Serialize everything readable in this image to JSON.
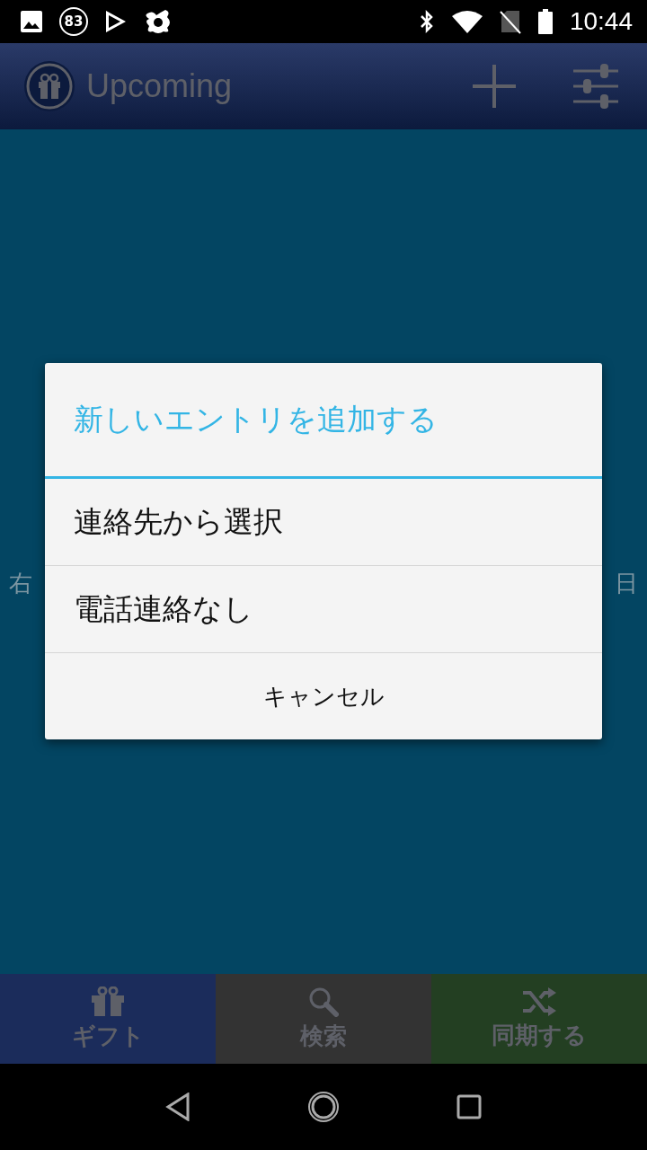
{
  "status_bar": {
    "notification_count": "83",
    "time": "10:44"
  },
  "app_bar": {
    "title": "Upcoming"
  },
  "background_text": {
    "left": "右",
    "right": "日"
  },
  "dialog": {
    "title": "新しいエントリを追加する",
    "options": [
      "連絡先から選択",
      "電話連絡なし"
    ],
    "cancel": "キャンセル"
  },
  "bottom_tabs": [
    {
      "label": "ギフト",
      "kind": "gift",
      "color": "#1b2c5b"
    },
    {
      "label": "検索",
      "kind": "search",
      "color": "#333333"
    },
    {
      "label": "同期する",
      "kind": "shuffle",
      "color": "#233f22"
    }
  ]
}
